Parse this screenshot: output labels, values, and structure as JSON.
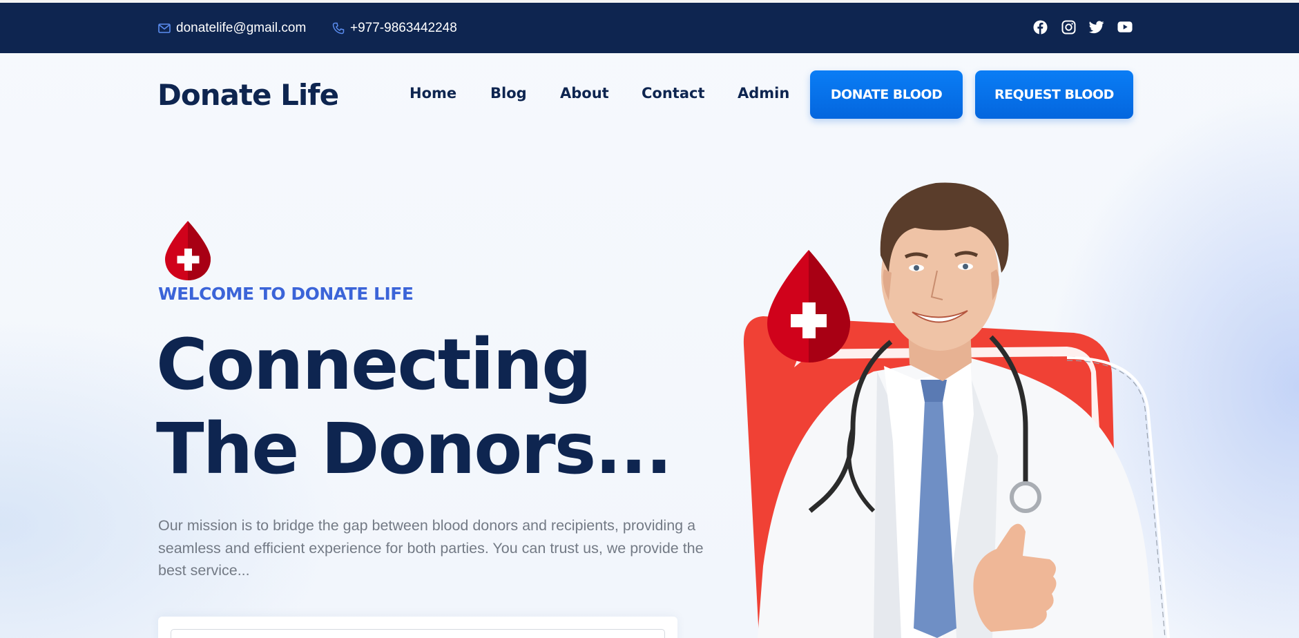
{
  "topbar": {
    "email": "donatelife@gmail.com",
    "phone": "+977-9863442248",
    "socials": [
      "facebook-icon",
      "instagram-icon",
      "twitter-icon",
      "youtube-icon"
    ]
  },
  "nav": {
    "logo": "Donate Life",
    "links": [
      "Home",
      "Blog",
      "About",
      "Contact",
      "Admin"
    ],
    "donate_button": "DONATE BLOOD",
    "request_button": "REQUEST BLOOD"
  },
  "hero": {
    "welcome": "WELCOME TO DONATE LIFE",
    "headline_line1": "Connecting",
    "headline_line2": "The Donors...",
    "mission": "Our mission is to bridge the gap between blood donors and recipients, providing a seamless and efficient experience for both parties. You can trust us, we provide the best service..."
  },
  "colors": {
    "navy": "#0e2550",
    "accent_blue": "#3b64d8",
    "button_blue": "#0a7df5",
    "blood_red": "#d0021b"
  }
}
